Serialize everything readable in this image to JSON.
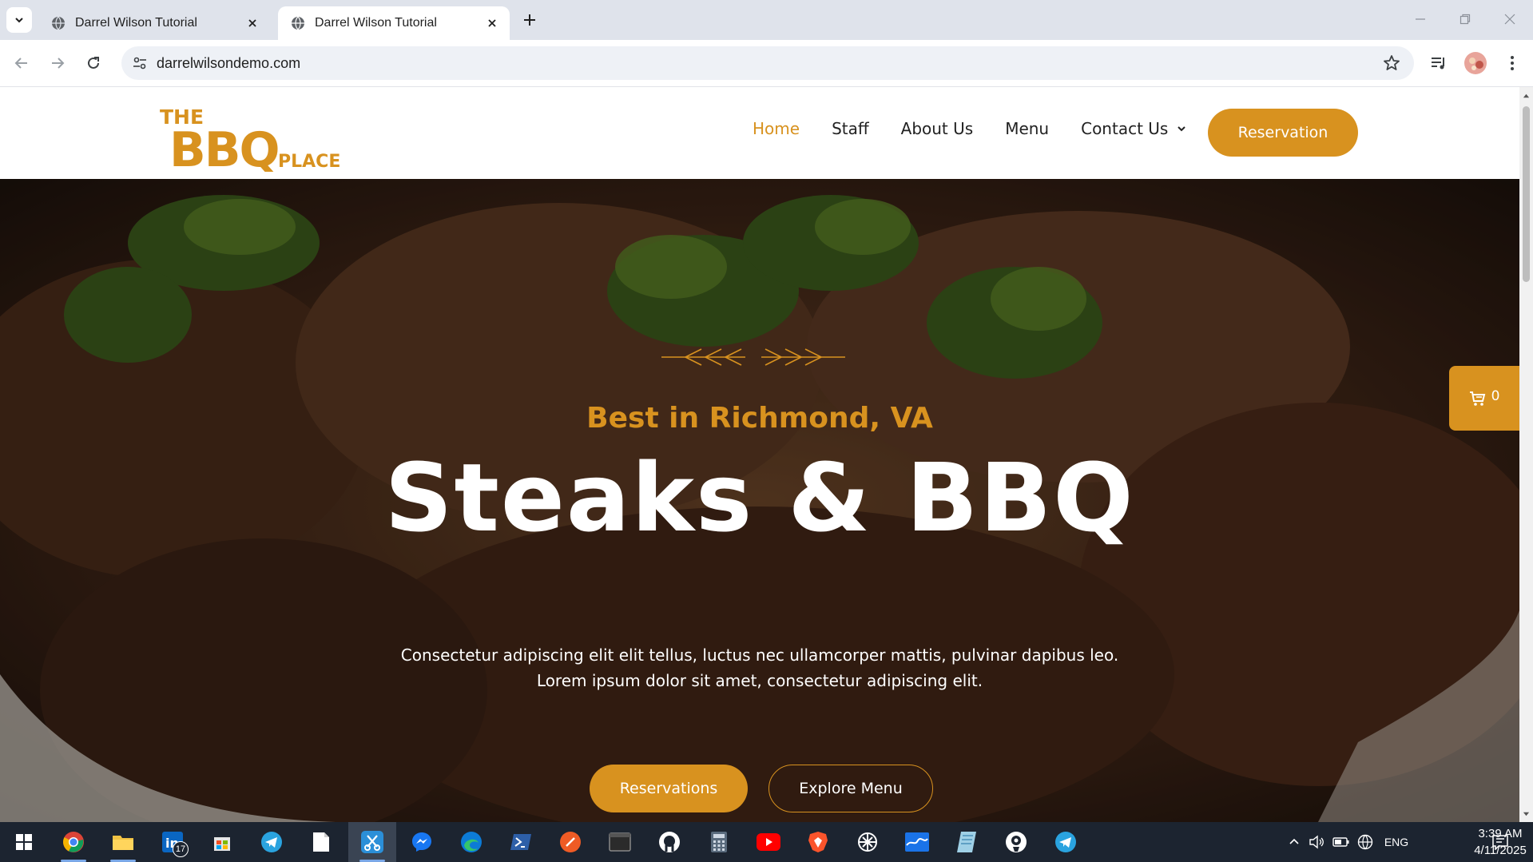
{
  "browser": {
    "tabs": [
      {
        "title": "Darrel Wilson Tutorial",
        "active": false
      },
      {
        "title": "Darrel Wilson Tutorial",
        "active": true
      }
    ],
    "url": "darrelwilsondemo.com"
  },
  "site": {
    "logo": {
      "line1": "THE",
      "line2": "BBQ",
      "line3": "PLACE"
    },
    "nav": [
      {
        "label": "Home",
        "current": true
      },
      {
        "label": "Staff"
      },
      {
        "label": "About Us"
      },
      {
        "label": "Menu"
      },
      {
        "label": "Contact Us",
        "has_dropdown": true
      }
    ],
    "header_cta": "Reservation",
    "hero": {
      "subtitle": "Best in Richmond, VA",
      "title": "Steaks & BBQ",
      "text": "Consectetur adipiscing elit elit tellus, luctus nec ullamcorper mattis, pulvinar dapibus leo. Lorem ipsum dolor sit amet, consectetur adipiscing elit.",
      "buttons": {
        "primary": "Reservations",
        "secondary": "Explore Menu"
      }
    },
    "cart": {
      "count": "0"
    },
    "accent_color": "#d8921f"
  },
  "taskbar": {
    "apps": [
      "windows-start",
      "chrome",
      "file-explorer",
      "linkedin",
      "microsoft-store",
      "telegram",
      "notepad",
      "snipping-tool",
      "messenger",
      "edge",
      "powershell",
      "postman",
      "terminal",
      "github",
      "calculator",
      "youtube",
      "brave",
      "chatgpt",
      "mail",
      "notes",
      "camo",
      "telegram"
    ],
    "linkedin_badge": "17",
    "language": "ENG",
    "time": "3:39 AM",
    "date": "4/11/2025"
  }
}
